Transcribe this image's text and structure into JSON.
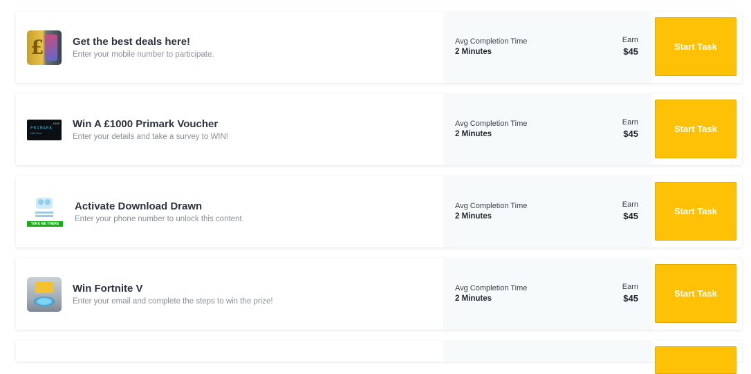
{
  "tasks": [
    {
      "title": "Get the best deals here!",
      "subtitle": "Enter your mobile number to participate.",
      "time_label": "Avg Completion Time",
      "time_value": "2 Minutes",
      "earn_label": "Earn",
      "earn_value": "$45",
      "button_label": "Start Task",
      "thumb_icon": "phone-deal-image"
    },
    {
      "title": "Win A £1000 Primark Voucher",
      "subtitle": "Enter your details and take a survey to WIN!",
      "time_label": "Avg Completion Time",
      "time_value": "2 Minutes",
      "earn_label": "Earn",
      "earn_value": "$45",
      "button_label": "Start Task",
      "thumb_icon": "primark-card-image",
      "thumb_text": "PRIMARK"
    },
    {
      "title": "Activate Download Drawn",
      "subtitle": "Enter your phone number to unlock this content.",
      "time_label": "Avg Completion Time",
      "time_value": "2 Minutes",
      "earn_label": "Earn",
      "earn_value": "$45",
      "button_label": "Start Task",
      "thumb_icon": "lottery-image",
      "thumb_text": "TAKE ME THERE"
    },
    {
      "title": "Win Fortnite V",
      "subtitle": "Enter your email and complete the steps to win the prize!",
      "time_label": "Avg Completion Time",
      "time_value": "2 Minutes",
      "earn_label": "Earn",
      "earn_value": "$45",
      "button_label": "Start Task",
      "thumb_icon": "fortnite-image"
    }
  ],
  "colors": {
    "button": "#ffc105",
    "meta_background": "#f6fafb",
    "title": "#2c3440",
    "subtitle": "#8a8f96"
  }
}
